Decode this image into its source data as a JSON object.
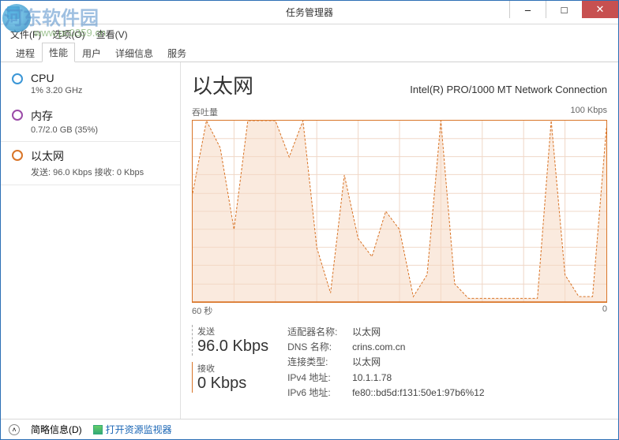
{
  "window": {
    "title": "任务管理器",
    "minimize": "–",
    "maximize": "□",
    "close": "✕"
  },
  "menu": {
    "file": "文件(F)",
    "options": "选项(O)",
    "view": "查看(V)"
  },
  "tabs": {
    "processes": "进程",
    "performance": "性能",
    "users": "用户",
    "details": "详细信息",
    "services": "服务"
  },
  "sidebar": {
    "cpu": {
      "label": "CPU",
      "sub": "1% 3.20 GHz"
    },
    "memory": {
      "label": "内存",
      "sub": "0.7/2.0 GB (35%)"
    },
    "ethernet": {
      "label": "以太网",
      "sub": "发送: 96.0 Kbps 接收: 0 Kbps"
    }
  },
  "main": {
    "title": "以太网",
    "adapter": "Intel(R) PRO/1000 MT Network Connection",
    "chart_top_left": "吞吐量",
    "chart_top_right": "100 Kbps",
    "chart_bottom_left": "60 秒",
    "chart_bottom_right": "0",
    "send_label": "发送",
    "send_value": "96.0 Kbps",
    "recv_label": "接收",
    "recv_value": "0 Kbps",
    "details": {
      "adapter_name_k": "适配器名称:",
      "adapter_name_v": "以太网",
      "dns_k": "DNS 名称:",
      "dns_v": "crins.com.cn",
      "conn_k": "连接类型:",
      "conn_v": "以太网",
      "ipv4_k": "IPv4 地址:",
      "ipv4_v": "10.1.1.78",
      "ipv6_k": "IPv6 地址:",
      "ipv6_v": "fe80::bd5d:f131:50e1:97b6%12"
    }
  },
  "footer": {
    "fewer": "简略信息(D)",
    "resmon": "打开资源监视器"
  },
  "watermark": {
    "text": "河东软件园",
    "url": "www.pc0359.cn"
  },
  "chart_data": {
    "type": "line",
    "title": "吞吐量",
    "xlabel": "60 秒",
    "ylabel": "Kbps",
    "ylim": [
      0,
      100
    ],
    "x_seconds": [
      60,
      58,
      56,
      54,
      52,
      50,
      48,
      46,
      44,
      42,
      40,
      38,
      36,
      34,
      32,
      30,
      28,
      26,
      24,
      22,
      20,
      18,
      16,
      14,
      12,
      10,
      8,
      6,
      4,
      2,
      0
    ],
    "series": [
      {
        "name": "发送 (Kbps)",
        "values": [
          60,
          100,
          85,
          40,
          100,
          100,
          100,
          80,
          100,
          30,
          5,
          70,
          35,
          25,
          50,
          40,
          3,
          15,
          100,
          10,
          2,
          2,
          2,
          2,
          2,
          2,
          100,
          15,
          3,
          3,
          96
        ]
      },
      {
        "name": "接收 (Kbps)",
        "values": [
          0,
          0,
          0,
          0,
          0,
          0,
          0,
          0,
          0,
          0,
          0,
          0,
          0,
          0,
          0,
          0,
          0,
          0,
          0,
          0,
          0,
          0,
          0,
          0,
          0,
          0,
          0,
          0,
          0,
          0,
          0
        ]
      }
    ]
  }
}
